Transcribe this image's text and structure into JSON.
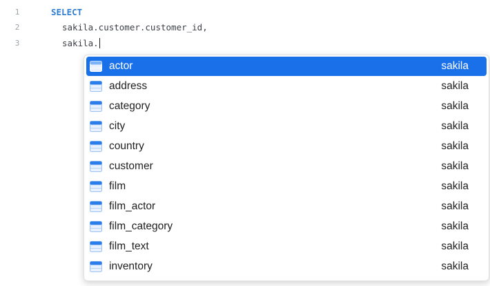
{
  "editor": {
    "lines": [
      {
        "number": "1",
        "text": "SELECT"
      },
      {
        "number": "2",
        "text": "sakila.customer.customer_id,"
      },
      {
        "number": "3",
        "text": "sakila."
      }
    ]
  },
  "autocomplete": {
    "selected_index": 0,
    "items": [
      {
        "name": "actor",
        "schema": "sakila",
        "icon": "table-icon"
      },
      {
        "name": "address",
        "schema": "sakila",
        "icon": "table-icon"
      },
      {
        "name": "category",
        "schema": "sakila",
        "icon": "table-icon"
      },
      {
        "name": "city",
        "schema": "sakila",
        "icon": "table-icon"
      },
      {
        "name": "country",
        "schema": "sakila",
        "icon": "table-icon"
      },
      {
        "name": "customer",
        "schema": "sakila",
        "icon": "table-icon"
      },
      {
        "name": "film",
        "schema": "sakila",
        "icon": "table-icon"
      },
      {
        "name": "film_actor",
        "schema": "sakila",
        "icon": "table-icon"
      },
      {
        "name": "film_category",
        "schema": "sakila",
        "icon": "table-icon"
      },
      {
        "name": "film_text",
        "schema": "sakila",
        "icon": "table-icon"
      },
      {
        "name": "inventory",
        "schema": "sakila",
        "icon": "table-icon"
      }
    ]
  },
  "colors": {
    "keyword": "#2f7dd3",
    "selection": "#1a70e8",
    "table_icon_header": "#2b7de9",
    "table_icon_body": "#e8f1fd"
  }
}
